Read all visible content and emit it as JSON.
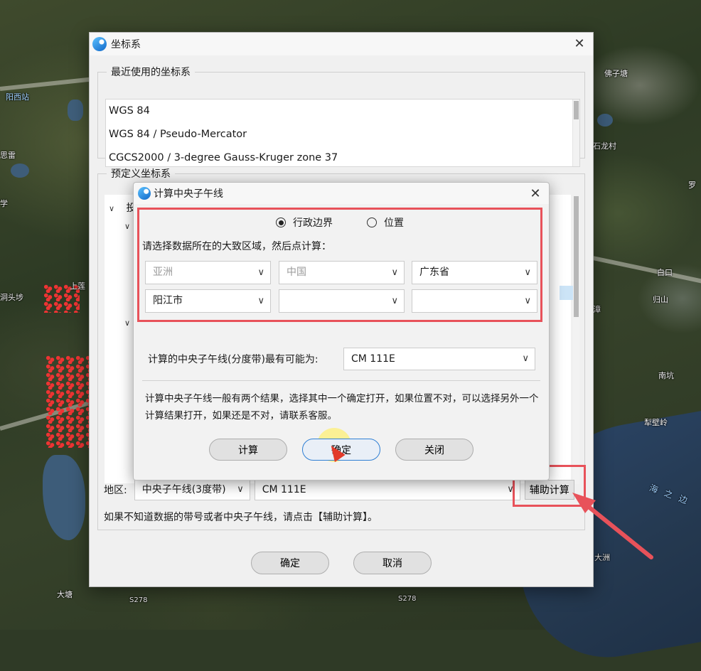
{
  "map": {
    "labels": [
      "阳西站",
      "思雷",
      "学",
      "上莲",
      "洞头埗",
      "佛子塘",
      "石龙村",
      "罗",
      "白口",
      "归山",
      "南坑",
      "犁壁岭",
      "大洲",
      "大塘",
      "S278",
      "S278",
      "漳"
    ],
    "river_label": "海之边"
  },
  "main": {
    "title": "坐标系",
    "close": "✕",
    "recent_legend": "最近使用的坐标系",
    "recent_items": [
      "WGS 84",
      "WGS 84 / Pseudo-Mercator",
      "CGCS2000 / 3-degree Gauss-Kruger zone 37"
    ],
    "predef_legend": "预定义坐标系",
    "tree_first": "投",
    "region_label": "地区:",
    "region_combo": "中央子午线(3度带)",
    "meridian_combo": "CM 111E",
    "aux_button": "辅助计算",
    "hint": "如果不知道数据的带号或者中央子午线，请点击【辅助计算】。",
    "ok": "确定",
    "cancel": "取消"
  },
  "sub": {
    "title": "计算中央子午线",
    "close": "✕",
    "radio_admin": "行政边界",
    "radio_position": "位置",
    "instruction": "请选择数据所在的大致区域，然后点计算：",
    "combo1": "亚洲",
    "combo2": "中国",
    "combo3": "广东省",
    "combo4": "阳江市",
    "combo5": "",
    "combo6": "",
    "calc_label": "计算的中央子午线(分度带)最有可能为:",
    "calc_result": "CM 111E",
    "note": "计算中央子午线一般有两个结果，选择其中一个确定打开，如果位置不对，可以选择另外一个计算结果打开，如果还是不对，请联系客服。",
    "btn_calc": "计算",
    "btn_ok": "确定",
    "btn_close": "关闭"
  },
  "icons": {
    "chevron": "∨",
    "dropdown": "⌄"
  },
  "colors": {
    "highlight_border": "#e8525a",
    "focus_border": "#2f7fd4"
  }
}
